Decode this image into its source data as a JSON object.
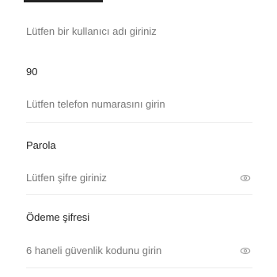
{
  "form": {
    "username_placeholder": "Lütfen bir kullanıcı adı giriniz",
    "country_code": "90",
    "phone_placeholder": "Lütfen telefon numarasını girin",
    "password_label": "Parola",
    "password_placeholder": "Lütfen şifre giriniz",
    "payment_password_label": "Ödeme şifresi",
    "payment_password_placeholder": "6 haneli güvenlik kodunu girin"
  },
  "icons": {
    "password_toggle": "eye-icon",
    "payment_password_toggle": "eye-icon"
  },
  "colors": {
    "placeholder": "#777777",
    "text": "#222222",
    "divider": "#ececec"
  }
}
